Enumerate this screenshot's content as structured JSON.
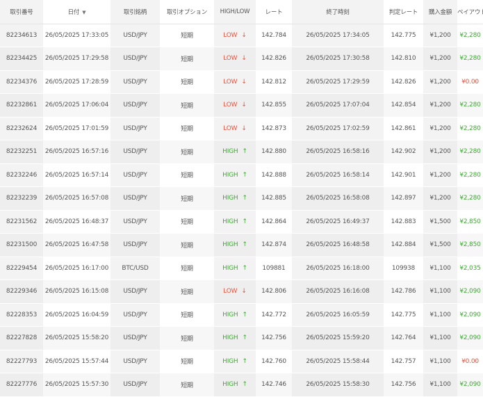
{
  "headers": {
    "id": "取引番号",
    "date": "日付",
    "pair": "取引銘柄",
    "option": "取引オプション",
    "direction": "HIGH/LOW",
    "rate": "レート",
    "end_time": "終了時刻",
    "judge_rate": "判定レート",
    "amount": "購入金額",
    "payout": "ペイアウト"
  },
  "sort_icon": "▼",
  "colors": {
    "high": "#3bab2f",
    "low": "#e8503a"
  },
  "rows": [
    {
      "id": "82234613",
      "date": "26/05/2025 17:33:05",
      "pair": "USD/JPY",
      "option": "短期",
      "direction": "LOW",
      "arrow": "↓",
      "rate": "142.784",
      "end_time": "26/05/2025 17:34:05",
      "judge_rate": "142.775",
      "amount": "¥1,200",
      "payout": "¥2,280"
    },
    {
      "id": "82234425",
      "date": "26/05/2025 17:29:58",
      "pair": "USD/JPY",
      "option": "短期",
      "direction": "LOW",
      "arrow": "↓",
      "rate": "142.826",
      "end_time": "26/05/2025 17:30:58",
      "judge_rate": "142.810",
      "amount": "¥1,200",
      "payout": "¥2,280"
    },
    {
      "id": "82234376",
      "date": "26/05/2025 17:28:59",
      "pair": "USD/JPY",
      "option": "短期",
      "direction": "LOW",
      "arrow": "↓",
      "rate": "142.812",
      "end_time": "26/05/2025 17:29:59",
      "judge_rate": "142.826",
      "amount": "¥1,200",
      "payout": "¥0.00"
    },
    {
      "id": "82232861",
      "date": "26/05/2025 17:06:04",
      "pair": "USD/JPY",
      "option": "短期",
      "direction": "LOW",
      "arrow": "↓",
      "rate": "142.855",
      "end_time": "26/05/2025 17:07:04",
      "judge_rate": "142.854",
      "amount": "¥1,200",
      "payout": "¥2,280"
    },
    {
      "id": "82232624",
      "date": "26/05/2025 17:01:59",
      "pair": "USD/JPY",
      "option": "短期",
      "direction": "LOW",
      "arrow": "↓",
      "rate": "142.873",
      "end_time": "26/05/2025 17:02:59",
      "judge_rate": "142.861",
      "amount": "¥1,200",
      "payout": "¥2,280"
    },
    {
      "id": "82232251",
      "date": "26/05/2025 16:57:16",
      "pair": "USD/JPY",
      "option": "短期",
      "direction": "HIGH",
      "arrow": "↑",
      "rate": "142.880",
      "end_time": "26/05/2025 16:58:16",
      "judge_rate": "142.902",
      "amount": "¥1,200",
      "payout": "¥2,280"
    },
    {
      "id": "82232246",
      "date": "26/05/2025 16:57:14",
      "pair": "USD/JPY",
      "option": "短期",
      "direction": "HIGH",
      "arrow": "↑",
      "rate": "142.888",
      "end_time": "26/05/2025 16:58:14",
      "judge_rate": "142.901",
      "amount": "¥1,200",
      "payout": "¥2,280"
    },
    {
      "id": "82232239",
      "date": "26/05/2025 16:57:08",
      "pair": "USD/JPY",
      "option": "短期",
      "direction": "HIGH",
      "arrow": "↑",
      "rate": "142.885",
      "end_time": "26/05/2025 16:58:08",
      "judge_rate": "142.897",
      "amount": "¥1,200",
      "payout": "¥2,280"
    },
    {
      "id": "82231562",
      "date": "26/05/2025 16:48:37",
      "pair": "USD/JPY",
      "option": "短期",
      "direction": "HIGH",
      "arrow": "↑",
      "rate": "142.864",
      "end_time": "26/05/2025 16:49:37",
      "judge_rate": "142.883",
      "amount": "¥1,500",
      "payout": "¥2,850"
    },
    {
      "id": "82231500",
      "date": "26/05/2025 16:47:58",
      "pair": "USD/JPY",
      "option": "短期",
      "direction": "HIGH",
      "arrow": "↑",
      "rate": "142.874",
      "end_time": "26/05/2025 16:48:58",
      "judge_rate": "142.884",
      "amount": "¥1,500",
      "payout": "¥2,850"
    },
    {
      "id": "82229454",
      "date": "26/05/2025 16:17:00",
      "pair": "BTC/USD",
      "option": "短期",
      "direction": "HIGH",
      "arrow": "↑",
      "rate": "109881",
      "end_time": "26/05/2025 16:18:00",
      "judge_rate": "109938",
      "amount": "¥1,100",
      "payout": "¥2,035"
    },
    {
      "id": "82229346",
      "date": "26/05/2025 16:15:08",
      "pair": "USD/JPY",
      "option": "短期",
      "direction": "LOW",
      "arrow": "↓",
      "rate": "142.806",
      "end_time": "26/05/2025 16:16:08",
      "judge_rate": "142.786",
      "amount": "¥1,100",
      "payout": "¥2,090"
    },
    {
      "id": "82228353",
      "date": "26/05/2025 16:04:59",
      "pair": "USD/JPY",
      "option": "短期",
      "direction": "HIGH",
      "arrow": "↑",
      "rate": "142.772",
      "end_time": "26/05/2025 16:05:59",
      "judge_rate": "142.775",
      "amount": "¥1,100",
      "payout": "¥2,090"
    },
    {
      "id": "82227828",
      "date": "26/05/2025 15:58:20",
      "pair": "USD/JPY",
      "option": "短期",
      "direction": "HIGH",
      "arrow": "↑",
      "rate": "142.756",
      "end_time": "26/05/2025 15:59:20",
      "judge_rate": "142.764",
      "amount": "¥1,100",
      "payout": "¥2,090"
    },
    {
      "id": "82227793",
      "date": "26/05/2025 15:57:44",
      "pair": "USD/JPY",
      "option": "短期",
      "direction": "HIGH",
      "arrow": "↑",
      "rate": "142.760",
      "end_time": "26/05/2025 15:58:44",
      "judge_rate": "142.757",
      "amount": "¥1,100",
      "payout": "¥0.00"
    },
    {
      "id": "82227776",
      "date": "26/05/2025 15:57:30",
      "pair": "USD/JPY",
      "option": "短期",
      "direction": "HIGH",
      "arrow": "↑",
      "rate": "142.746",
      "end_time": "26/05/2025 15:58:30",
      "judge_rate": "142.756",
      "amount": "¥1,100",
      "payout": "¥2,090"
    }
  ]
}
